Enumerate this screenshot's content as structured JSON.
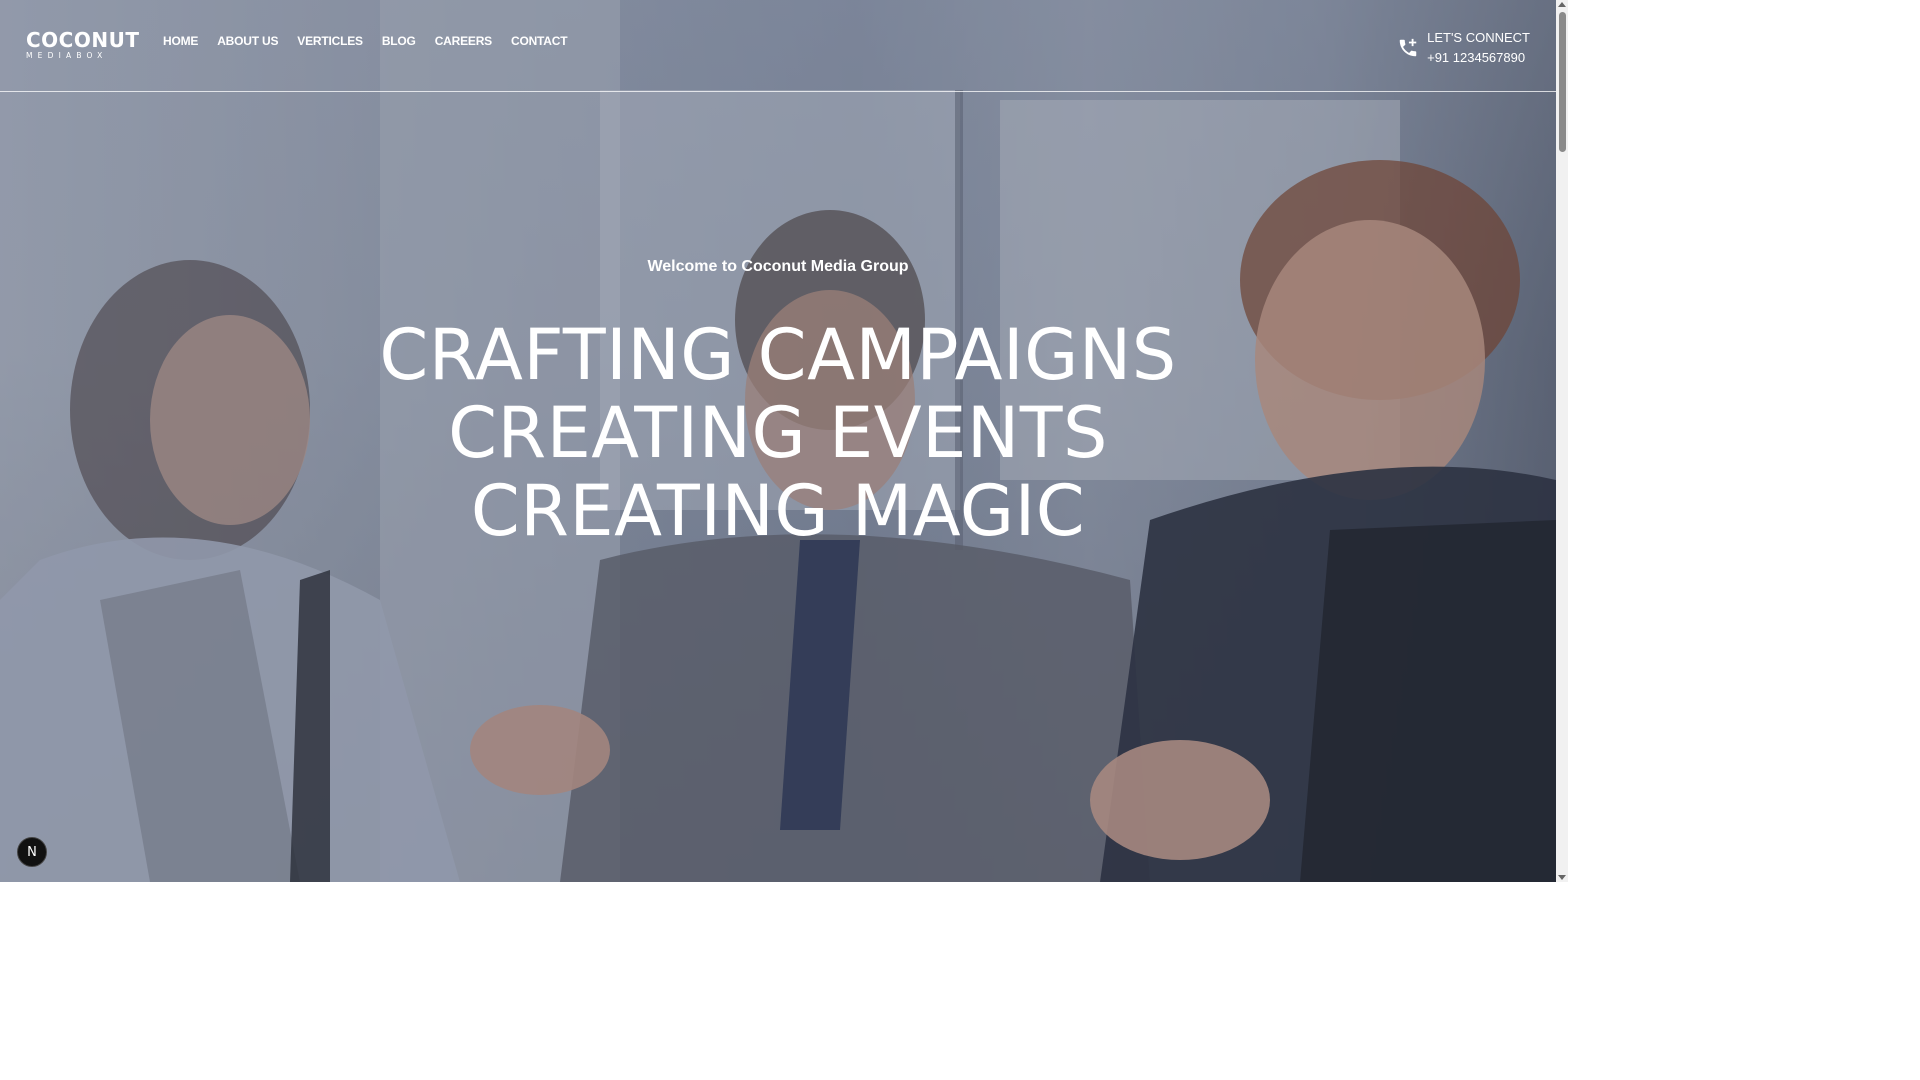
{
  "brand": {
    "logo_main": "COCONUT",
    "logo_sub": "MEDIABOX"
  },
  "nav": {
    "items": [
      {
        "label": "HOME"
      },
      {
        "label": "ABOUT US"
      },
      {
        "label": "VERTICLES"
      },
      {
        "label": "BLOG"
      },
      {
        "label": "CAREERS"
      },
      {
        "label": "CONTACT"
      }
    ]
  },
  "connect": {
    "label": "LET'S CONNECT",
    "phone": "+91 1234567890",
    "icon": "phone-add-icon"
  },
  "hero": {
    "welcome": "Welcome to Coconut Media Group",
    "lines": [
      "CRAFTING CAMPAIGNS",
      "CREATING EVENTS",
      "CREATING MAGIC"
    ]
  },
  "badge": {
    "letter": "N"
  },
  "colors": {
    "text": "#ffffff",
    "overlay": "#28304a"
  }
}
